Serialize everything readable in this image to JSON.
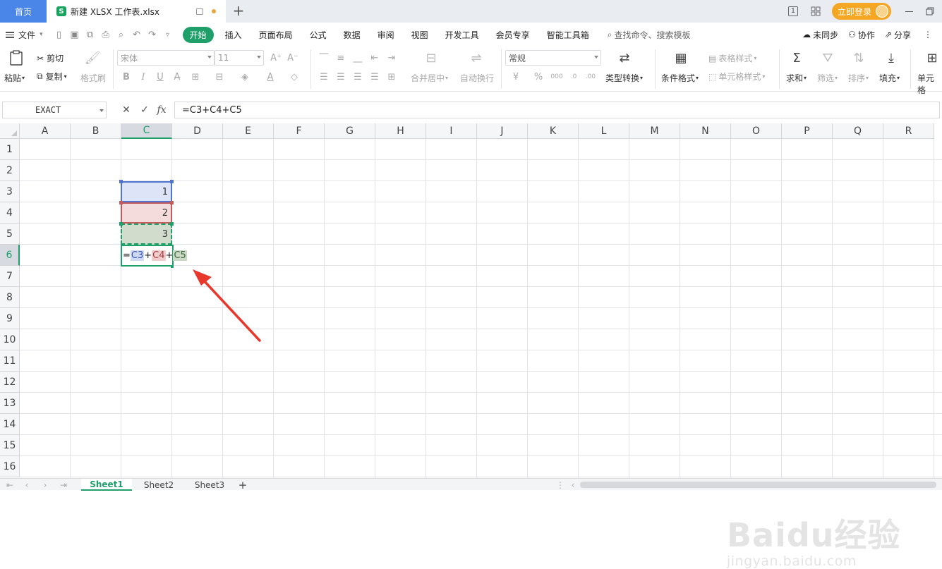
{
  "tabbar": {
    "home_label": "首页",
    "doc_icon_letter": "S",
    "doc_title": "新建 XLSX 工作表.xlsx",
    "new_tab": "+",
    "login_label": "立即登录",
    "page_indicator": "1"
  },
  "menu": {
    "file_label": "文件",
    "items": [
      "开始",
      "插入",
      "页面布局",
      "公式",
      "数据",
      "审阅",
      "视图",
      "开发工具",
      "会员专享",
      "智能工具箱"
    ],
    "active_index": 0,
    "search_placeholder": "查找命令、搜索模板",
    "unsynced": "未同步",
    "collaborate": "协作",
    "share": "分享"
  },
  "ribbon": {
    "paste": "粘贴",
    "cut": "剪切",
    "copy": "复制",
    "format_painter": "格式刷",
    "font_name": "宋体",
    "font_size": "11",
    "merge_center": "合并居中",
    "wrap_text": "自动换行",
    "number_format": "常规",
    "type_convert": "类型转换",
    "conditional_format": "条件格式",
    "table_style": "表格样式",
    "cell_style": "单元格样式",
    "sum": "求和",
    "filter": "筛选",
    "sort": "排序",
    "fill": "填充",
    "cell": "单元格"
  },
  "formula_bar": {
    "name_box": "EXACT",
    "cancel": "✕",
    "confirm": "✓",
    "fx": "fx",
    "formula": "=C3+C4+C5"
  },
  "grid": {
    "columns": [
      "A",
      "B",
      "C",
      "D",
      "E",
      "F",
      "G",
      "H",
      "I",
      "J",
      "K",
      "L",
      "M",
      "N",
      "O",
      "P",
      "Q",
      "R"
    ],
    "rows": [
      "1",
      "2",
      "3",
      "4",
      "5",
      "6",
      "7",
      "8",
      "9",
      "10",
      "11",
      "12",
      "13",
      "14",
      "15",
      "16"
    ],
    "selected_column": "C",
    "selected_row": "6",
    "cells": {
      "C3": "1",
      "C4": "2",
      "C5": "3"
    },
    "editing_cell": {
      "eq": "=",
      "ref1": "C3",
      "plus1": "+",
      "ref2": "C4",
      "plus2": "+",
      "ref3": "C5"
    }
  },
  "sheets": {
    "tabs": [
      "Sheet1",
      "Sheet2",
      "Sheet3"
    ],
    "active_index": 0,
    "add": "+"
  },
  "watermark": {
    "line1": "Baidu经验",
    "line2": "jingyan.baidu.com"
  },
  "colors": {
    "accent_green": "#1f9f6a",
    "ref_blue": "#4f73cf",
    "ref_red": "#c55a5a",
    "arrow_red": "#e8382b",
    "login_orange": "#f5a623"
  }
}
